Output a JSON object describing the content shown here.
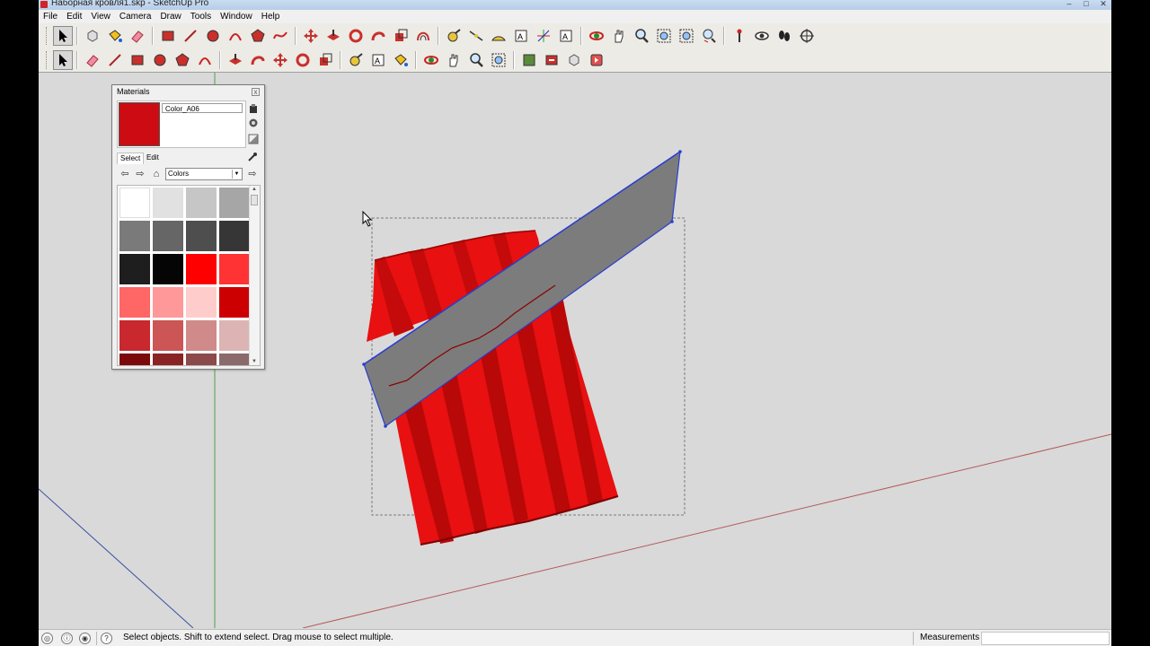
{
  "window": {
    "title": "Наборная кровля1.skp - SketchUp Pro",
    "controls": [
      "–",
      "□",
      "✕"
    ]
  },
  "menu": [
    "File",
    "Edit",
    "View",
    "Camera",
    "Draw",
    "Tools",
    "Window",
    "Help"
  ],
  "toolbar": {
    "row1_icons": [
      "select-icon",
      "component-icon",
      "paint-bucket-icon",
      "eraser-icon",
      "rectangle-icon",
      "line-icon",
      "circle-icon",
      "arc-icon",
      "polygon-icon",
      "freehand-icon",
      "move-icon",
      "push-pull-icon",
      "rotate-icon",
      "follow-me-icon",
      "scale-icon",
      "offset-icon",
      "tape-measure-icon",
      "dimension-icon",
      "protractor-icon",
      "text-icon",
      "axes-icon",
      "3d-text-icon",
      "orbit-icon",
      "pan-icon",
      "zoom-icon",
      "zoom-window-icon",
      "zoom-extents-icon",
      "previous-view-icon",
      "position-camera-icon",
      "look-around-icon",
      "walk-icon",
      "section-plane-icon"
    ],
    "row2_icons": [
      "select-icon",
      "eraser-icon",
      "line-icon",
      "rectangle-icon",
      "circle-icon",
      "polygon-icon",
      "arc-icon",
      "push-pull-icon",
      "follow-me-icon",
      "move-icon",
      "rotate-icon",
      "scale-icon",
      "tape-measure-icon",
      "text-icon",
      "paint-bucket-icon",
      "orbit-icon",
      "pan-icon",
      "zoom-icon",
      "zoom-extents-icon",
      "get-models-icon",
      "share-model-icon",
      "components-icon",
      "extension-icon"
    ]
  },
  "materials_panel": {
    "title": "Materials",
    "close": "x",
    "current_material": "Color_A06",
    "current_color": "#cc0c12",
    "tabs": [
      "Select",
      "Edit"
    ],
    "active_tab": "Select",
    "library": "Colors",
    "swatches": [
      "#ffffff",
      "#e1e1e1",
      "#c6c6c6",
      "#a6a6a6",
      "#7a7a7a",
      "#666666",
      "#4e4e4e",
      "#363636",
      "#1e1e1e",
      "#050505",
      "#ff0000",
      "#ff3333",
      "#ff6666",
      "#ff9999",
      "#ffcccc",
      "#cc0000",
      "#c8282e",
      "#cc5555",
      "#d08a8a",
      "#dcb4b4",
      "#7d0a0a",
      "#8a2424",
      "#8c4a4a",
      "#8a6a6a"
    ]
  },
  "status": {
    "hint": "Select objects. Shift to extend select. Drag mouse to select multiple.",
    "measurements_label": "Measurements",
    "measurements_value": "",
    "icons": [
      "georeference-icon",
      "credits-icon",
      "user-icon",
      "help-icon"
    ]
  }
}
